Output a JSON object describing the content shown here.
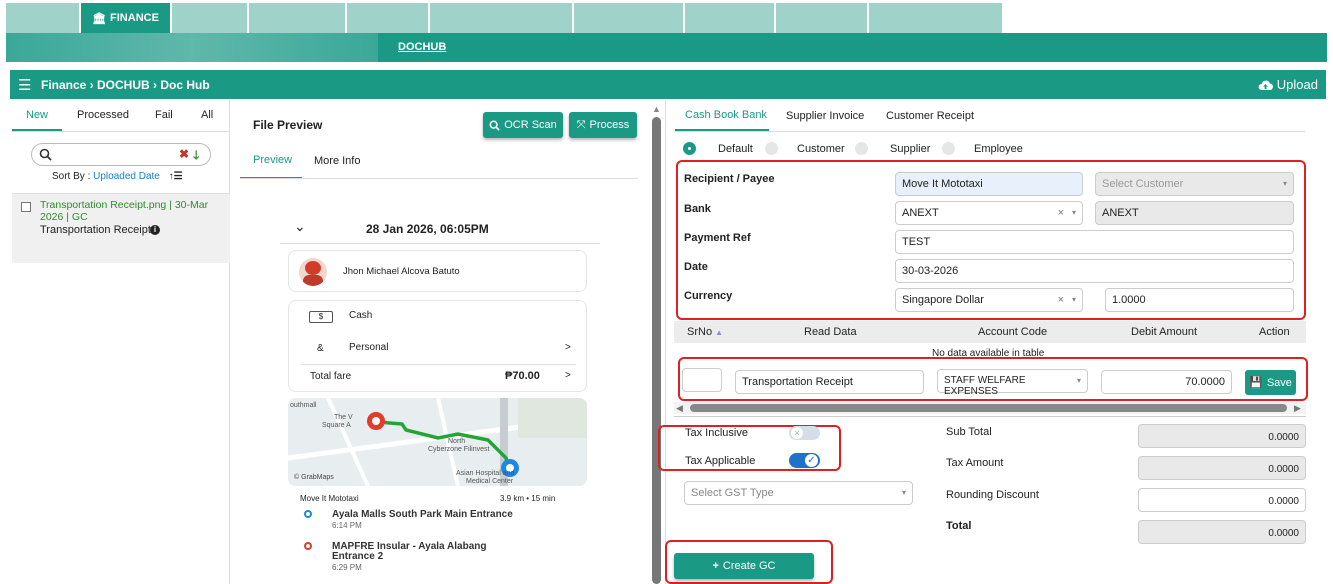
{
  "topnav": {
    "active_tab": "FINANCE"
  },
  "subnav": {
    "link": "DOCHUB"
  },
  "breadcrumb": {
    "text": "Finance › DOCHUB › Doc Hub",
    "upload_label": "Upload"
  },
  "left": {
    "tabs": [
      "New",
      "Processed",
      "Fail",
      "All"
    ],
    "search_placeholder": "",
    "sort_prefix": "Sort By :",
    "sort_field": "Uploaded Date",
    "file": {
      "name_line1": "Transportation Receipt.png | 30-Mar",
      "name_line2": "2026 | GC",
      "doc_type": "Transportation Receipt"
    }
  },
  "preview": {
    "title": "File Preview",
    "ocr_label": "OCR Scan",
    "process_label": "Process",
    "tabs": [
      "Preview",
      "More Info"
    ],
    "receipt": {
      "datetime": "28 Jan 2026, 06:05PM",
      "driver": "Jhon Michael Alcova Batuto",
      "payment": "Cash",
      "profile": "Personal",
      "total_label": "Total fare",
      "total_value": "₱70.00",
      "map_labels": [
        "outhmall",
        "The V",
        "Square A",
        "North",
        "Cyberzone Filinvest",
        "Asian Hospital and",
        "Medical Center",
        "© GrabMaps"
      ],
      "service": "Move It Mototaxi",
      "distance": "3.9 km • 15 min",
      "pickup": "Ayala Malls South Park Main Entrance",
      "pickup_time": "6:14 PM",
      "dropoff_line1": "MAPFRE Insular - Ayala Alabang",
      "dropoff_line2": "Entrance 2",
      "dropoff_time": "6:29 PM"
    }
  },
  "right": {
    "tabs": [
      "Cash Book Bank",
      "Supplier Invoice",
      "Customer Receipt"
    ],
    "radios": [
      "Default",
      "Customer",
      "Supplier",
      "Employee"
    ],
    "form": {
      "recipient_label": "Recipient / Payee",
      "recipient_value": "Move It Mototaxi",
      "customer_placeholder": "Select Customer",
      "bank_label": "Bank",
      "bank_value": "ANEXT",
      "bank_readonly": "ANEXT",
      "payref_label": "Payment Ref",
      "payref_value": "TEST",
      "date_label": "Date",
      "date_value": "30-03-2026",
      "currency_label": "Currency",
      "currency_value": "Singapore Dollar",
      "rate_value": "1.0000"
    },
    "table": {
      "headers": [
        "SrNo",
        "Read Data",
        "Account Code",
        "Debit Amount",
        "Action"
      ],
      "empty_text": "No data available in table",
      "row": {
        "srno": "",
        "read_data": "Transportation Receipt",
        "account": "STAFF WELFARE EXPENSES",
        "amount": "70.0000",
        "save_label": "Save"
      }
    },
    "tax": {
      "inclusive_label": "Tax Inclusive",
      "applicable_label": "Tax Applicable",
      "gst_placeholder": "Select GST Type"
    },
    "summary": {
      "subtotal_label": "Sub Total",
      "subtotal": "0.0000",
      "tax_label": "Tax Amount",
      "tax": "0.0000",
      "rounding_label": "Rounding Discount",
      "rounding": "0.0000",
      "total_label": "Total",
      "total": "0.0000"
    },
    "create_label": "Create GC"
  },
  "colors": {
    "accent": "#1a9a85",
    "highlight": "#e02020"
  }
}
